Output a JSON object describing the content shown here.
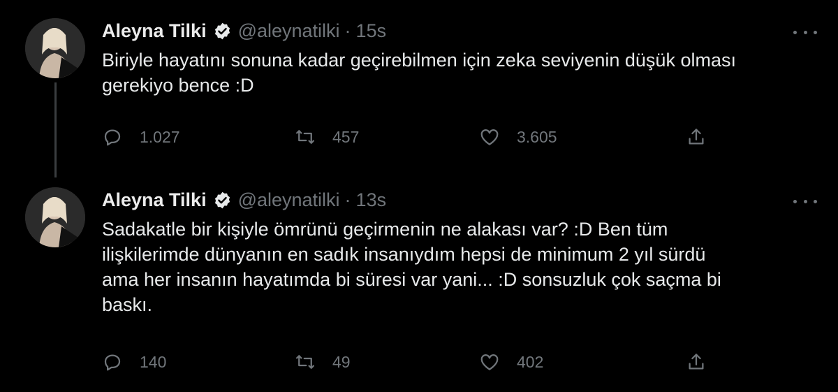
{
  "colors": {
    "background": "#000000",
    "text_primary": "#e7e9ea",
    "text_secondary": "#71767b",
    "thread_line": "#3a3d40",
    "verified_badge": "#e7e9ea"
  },
  "tweets": [
    {
      "author": {
        "name": "Aleyna Tilki",
        "handle": "@aleynatilki",
        "verified_icon": "verified-badge-icon",
        "avatar_icon": "avatar-photo"
      },
      "separator": "·",
      "time": "15s",
      "lines": [
        "Biriyle hayatını sonuna kadar geçirebilmen için zeka seviyenin düşük olması",
        "gerekiyo bence :D"
      ],
      "stats": {
        "replies": "1.027",
        "retweets": "457",
        "likes": "3.605"
      },
      "icons": {
        "reply": "reply-icon",
        "retweet": "retweet-icon",
        "like": "heart-icon",
        "share": "share-icon",
        "more": "more-dots-icon"
      }
    },
    {
      "author": {
        "name": "Aleyna Tilki",
        "handle": "@aleynatilki",
        "verified_icon": "verified-badge-icon",
        "avatar_icon": "avatar-photo"
      },
      "separator": "·",
      "time": "13s",
      "lines": [
        "Sadakatle bir kişiyle ömrünü geçirmenin ne alakası var? :D Ben tüm",
        "ilişkilerimde dünyanın en sadık insanıydım hepsi de minimum 2 yıl sürdü",
        "ama her insanın hayatımda bi süresi var yani... :D sonsuzluk çok saçma bi",
        "baskı."
      ],
      "stats": {
        "replies": "140",
        "retweets": "49",
        "likes": "402"
      },
      "icons": {
        "reply": "reply-icon",
        "retweet": "retweet-icon",
        "like": "heart-icon",
        "share": "share-icon",
        "more": "more-dots-icon"
      }
    }
  ]
}
